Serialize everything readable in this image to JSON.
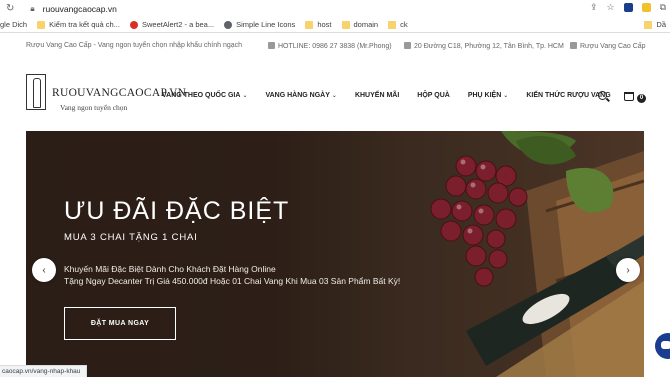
{
  "browser": {
    "url": "ruouvangcaocap.vn",
    "status_url": "caocap.vn/vang-nhap-khau",
    "bookmarks": [
      {
        "label": "gle Dich",
        "icon": "translate-icon"
      },
      {
        "label": "Kiểm tra kết quả ch...",
        "icon": "folder-icon"
      },
      {
        "label": "SweetAlert2 - a bea...",
        "icon": "sweetalert-icon"
      },
      {
        "label": "Simple Line Icons",
        "icon": "simpleline-icon"
      },
      {
        "label": "host",
        "icon": "folder-icon"
      },
      {
        "label": "domain",
        "icon": "folder-icon"
      },
      {
        "label": "ck",
        "icon": "folder-icon"
      },
      {
        "label": "Dầ",
        "icon": "folder-icon"
      }
    ]
  },
  "topbar": {
    "tagline": "Rượu Vang Cao Cấp - Vang ngon tuyển chọn nhập khẩu chính ngạch",
    "hotline": "HOTLINE: 0986 27 3838 (Mr.Phong)",
    "address": "20 Đường C18, Phường 12, Tân Bình, Tp. HCM",
    "facebook": "Rượu Vang Cao Cấp"
  },
  "header": {
    "logo_text": "RUOUVANGCAOCAP.VN",
    "logo_sub": "Vang ngon tuyển chọn",
    "menu": [
      {
        "label": "VANG THEO QUỐC GIA",
        "dropdown": true
      },
      {
        "label": "VANG HÀNG NGÀY",
        "dropdown": true
      },
      {
        "label": "KHUYẾN MÃI",
        "dropdown": false
      },
      {
        "label": "HỘP QUÀ",
        "dropdown": false
      },
      {
        "label": "PHỤ KIỆN",
        "dropdown": true
      },
      {
        "label": "KIẾN THỨC RƯỢU VANG",
        "dropdown": false
      }
    ],
    "cart_count": "0"
  },
  "hero": {
    "title": "ƯU ĐÃI ĐẶC BIỆT",
    "subtitle": "MUA 3 CHAI TẶNG 1 CHAI",
    "desc_line1": "Khuyến Mãi Đặc Biệt Dành Cho Khách Đặt Hàng Online",
    "desc_line2": "Tặng Ngay Decanter Trị Giá 450.000đ Hoặc 01 Chai Vang Khi Mua 03 Sản Phẩm Bất Kỳ!",
    "button_label": "ĐẶT MUA NGAY"
  },
  "colors": {
    "hero_bg": "#2b1e16",
    "chat_bubble": "#1c3d8f"
  }
}
